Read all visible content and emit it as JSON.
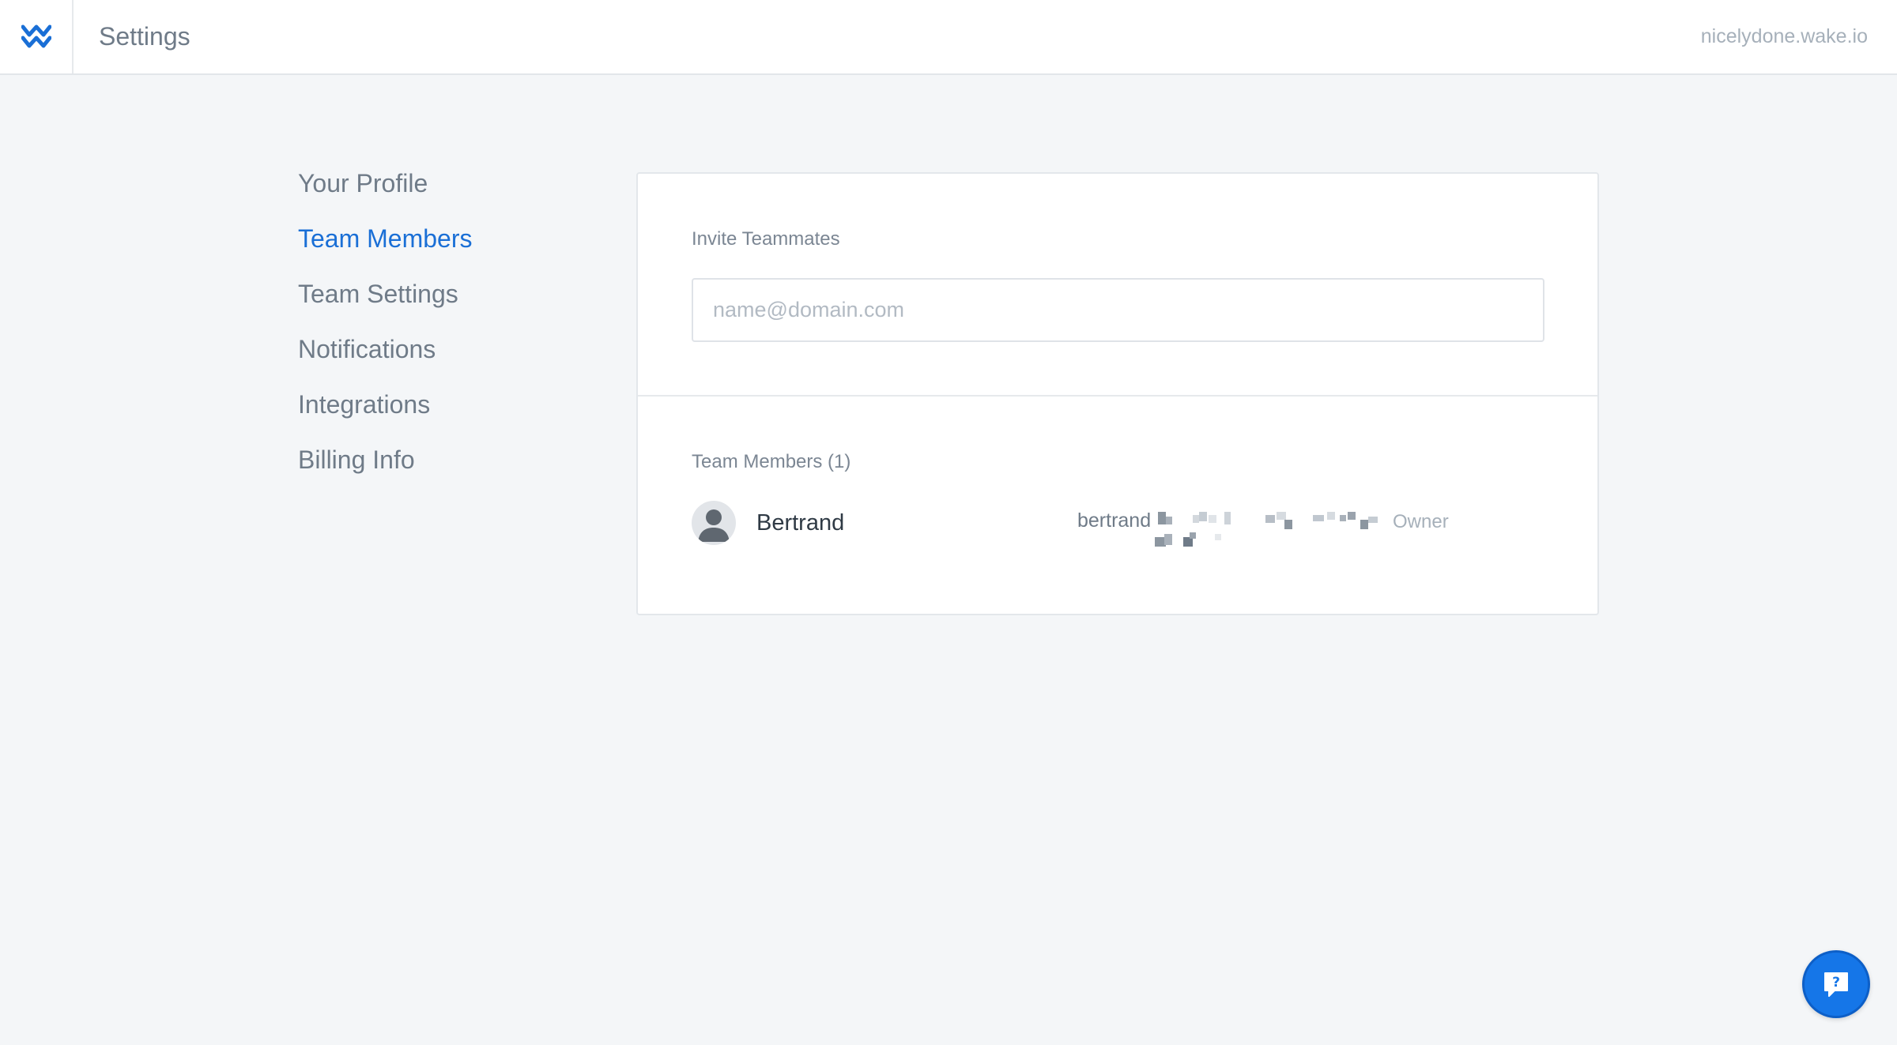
{
  "header": {
    "title": "Settings",
    "domain": "nicelydone.wake.io",
    "logo_icon": "wake-logo-icon",
    "accent_color": "#1a6fd6"
  },
  "sidebar": {
    "items": [
      {
        "label": "Your Profile",
        "active": false
      },
      {
        "label": "Team Members",
        "active": true
      },
      {
        "label": "Team Settings",
        "active": false
      },
      {
        "label": "Notifications",
        "active": false
      },
      {
        "label": "Integrations",
        "active": false
      },
      {
        "label": "Billing Info",
        "active": false
      }
    ]
  },
  "invite": {
    "label": "Invite Teammates",
    "placeholder": "name@domain.com",
    "value": ""
  },
  "members": {
    "label": "Team Members (1)",
    "list": [
      {
        "name": "Bertrand",
        "email": "bertrand",
        "role": "Owner",
        "avatar_icon": "user-avatar-icon"
      }
    ]
  },
  "help": {
    "icon": "help-chat-icon",
    "color": "#1576e8"
  }
}
